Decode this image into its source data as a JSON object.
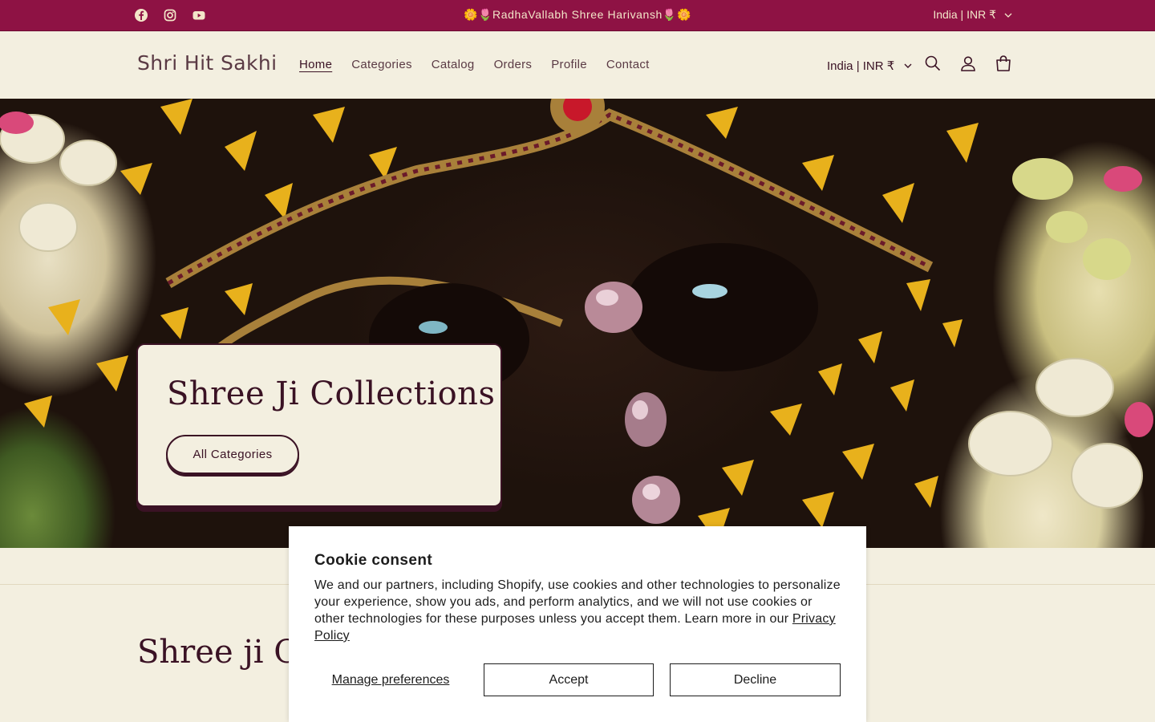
{
  "announcement": {
    "text": "🌼🌷RadhaVallabh Shree Harivansh🌷🌼",
    "country_selector": "India | INR ₹",
    "social": [
      "facebook-icon",
      "instagram-icon",
      "youtube-icon"
    ]
  },
  "header": {
    "logo": "Shri Hit Sakhi",
    "nav": [
      "Home",
      "Categories",
      "Catalog",
      "Orders",
      "Profile",
      "Contact"
    ],
    "country_selector": "India | INR ₹",
    "icons": [
      "search-icon",
      "account-icon",
      "cart-icon"
    ]
  },
  "hero": {
    "title": "Shree Ji Collections",
    "button": "All Categories"
  },
  "section": {
    "title": "Shree ji Collections"
  },
  "cookie": {
    "title": "Cookie consent",
    "body": "We and our partners, including Shopify, use cookies and other technologies to personalize your experience, show you ads, and perform analytics, and we will not use cookies or other technologies for these purposes unless you accept them. Learn more in our ",
    "link": "Privacy Policy",
    "manage": "Manage preferences",
    "accept": "Accept",
    "decline": "Decline"
  },
  "colors": {
    "announcement_bg": "#8e1244",
    "page_bg": "#f3efe0",
    "text": "#3a1224"
  }
}
